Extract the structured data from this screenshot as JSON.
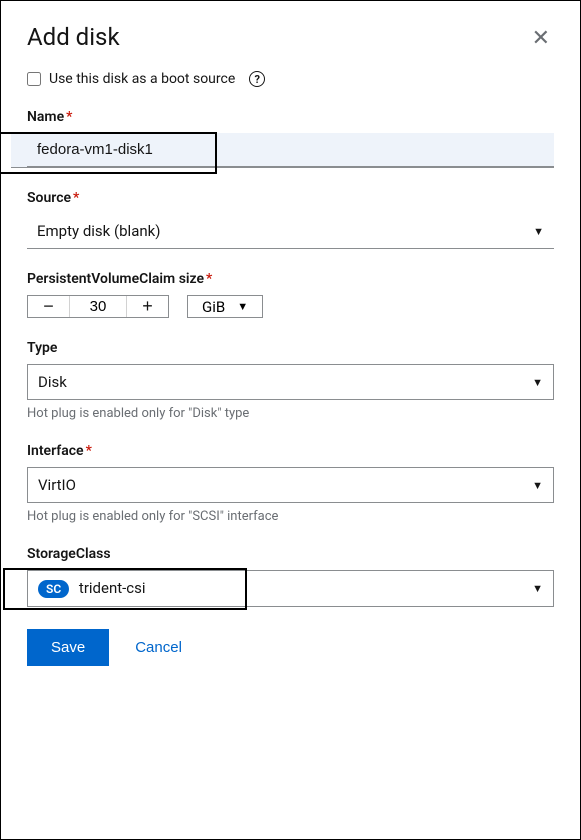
{
  "title": "Add disk",
  "bootSource": {
    "label": "Use this disk as a boot source",
    "checked": false
  },
  "name": {
    "label": "Name",
    "value": "fedora-vm1-disk1"
  },
  "source": {
    "label": "Source",
    "value": "Empty disk (blank)"
  },
  "pvcSize": {
    "label": "PersistentVolumeClaim size",
    "value": "30",
    "unit": "GiB"
  },
  "type": {
    "label": "Type",
    "value": "Disk",
    "helper": "Hot plug is enabled only for \"Disk\" type"
  },
  "interface": {
    "label": "Interface",
    "value": "VirtIO",
    "helper": "Hot plug is enabled only for \"SCSI\" interface"
  },
  "storageClass": {
    "label": "StorageClass",
    "badge": "SC",
    "value": "trident-csi"
  },
  "actions": {
    "save": "Save",
    "cancel": "Cancel"
  }
}
